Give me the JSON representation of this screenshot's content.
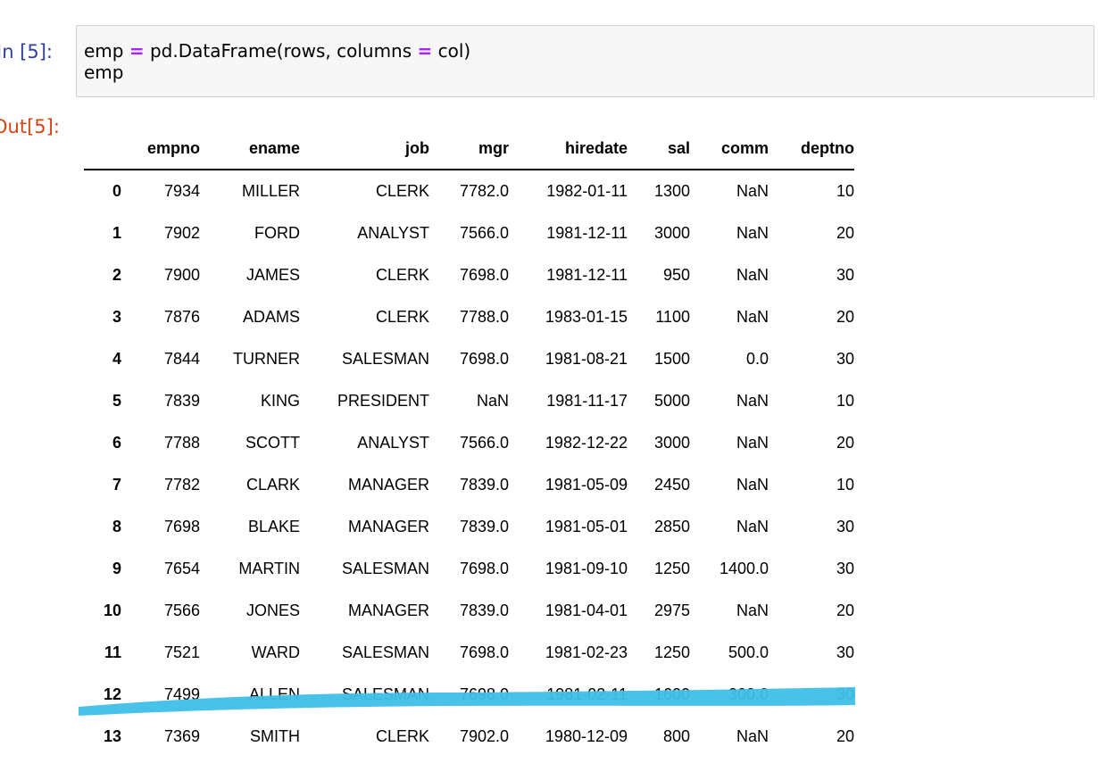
{
  "input_prompt": "In [5]:",
  "output_prompt": "Out[5]:",
  "code": {
    "line1_a": "emp ",
    "line1_op": "=",
    "line1_b": " pd.DataFrame(rows, columns ",
    "line1_op2": "=",
    "line1_c": " col)",
    "line2": "emp"
  },
  "table": {
    "columns": [
      "",
      "empno",
      "ename",
      "job",
      "mgr",
      "hiredate",
      "sal",
      "comm",
      "deptno"
    ],
    "rows": [
      [
        "0",
        "7934",
        "MILLER",
        "CLERK",
        "7782.0",
        "1982-01-11",
        "1300",
        "NaN",
        "10"
      ],
      [
        "1",
        "7902",
        "FORD",
        "ANALYST",
        "7566.0",
        "1981-12-11",
        "3000",
        "NaN",
        "20"
      ],
      [
        "2",
        "7900",
        "JAMES",
        "CLERK",
        "7698.0",
        "1981-12-11",
        "950",
        "NaN",
        "30"
      ],
      [
        "3",
        "7876",
        "ADAMS",
        "CLERK",
        "7788.0",
        "1983-01-15",
        "1100",
        "NaN",
        "20"
      ],
      [
        "4",
        "7844",
        "TURNER",
        "SALESMAN",
        "7698.0",
        "1981-08-21",
        "1500",
        "0.0",
        "30"
      ],
      [
        "5",
        "7839",
        "KING",
        "PRESIDENT",
        "NaN",
        "1981-11-17",
        "5000",
        "NaN",
        "10"
      ],
      [
        "6",
        "7788",
        "SCOTT",
        "ANALYST",
        "7566.0",
        "1982-12-22",
        "3000",
        "NaN",
        "20"
      ],
      [
        "7",
        "7782",
        "CLARK",
        "MANAGER",
        "7839.0",
        "1981-05-09",
        "2450",
        "NaN",
        "10"
      ],
      [
        "8",
        "7698",
        "BLAKE",
        "MANAGER",
        "7839.0",
        "1981-05-01",
        "2850",
        "NaN",
        "30"
      ],
      [
        "9",
        "7654",
        "MARTIN",
        "SALESMAN",
        "7698.0",
        "1981-09-10",
        "1250",
        "1400.0",
        "30"
      ],
      [
        "10",
        "7566",
        "JONES",
        "MANAGER",
        "7839.0",
        "1981-04-01",
        "2975",
        "NaN",
        "20"
      ],
      [
        "11",
        "7521",
        "WARD",
        "SALESMAN",
        "7698.0",
        "1981-02-23",
        "1250",
        "500.0",
        "30"
      ],
      [
        "12",
        "7499",
        "ALLEN",
        "SALESMAN",
        "7698.0",
        "1981-02-11",
        "1600",
        "300.0",
        "30"
      ],
      [
        "13",
        "7369",
        "SMITH",
        "CLERK",
        "7902.0",
        "1980-12-09",
        "800",
        "NaN",
        "20"
      ]
    ]
  },
  "highlight_color": "#3fbfe8",
  "highlighted_row": "12"
}
